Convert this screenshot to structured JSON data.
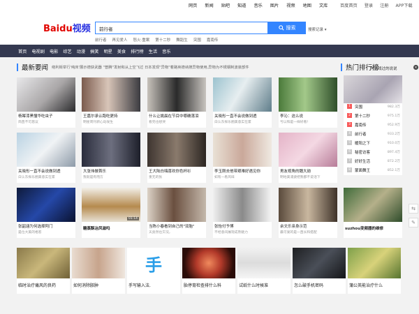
{
  "top_nav": {
    "center": [
      "网页",
      "新闻",
      "贴吧",
      "知道",
      "音乐",
      "图片",
      "视频",
      "地图",
      "文库"
    ],
    "right": [
      "百度首页",
      "登录",
      "注册",
      "APP下载"
    ]
  },
  "logo": {
    "part1": "Baidu",
    "part2": "视频"
  },
  "search": {
    "value": "前行者",
    "button": "搜索",
    "history": "搜索记录"
  },
  "suggestions": [
    "前行者",
    "再见爱人",
    "怒火·重案",
    "第十二秒",
    "舞蹈生",
    "突围",
    "嘉南传"
  ],
  "category_nav": [
    "首页",
    "电视剧",
    "电影",
    "综艺",
    "动漫",
    "搞笑",
    "明星",
    "美食",
    "排行榜",
    "生活",
    "音乐"
  ],
  "news": {
    "title": "最新要闻",
    "ticker": "络利街举行'纯床'展示德获武器    \"普腾\"发射和从上空飞过    日本发现\"异物\"着路英德纳搜异物使用,异物为不锈钢制波装部件"
  },
  "cards": [
    {
      "title": "杨幂漆黑懂华吃虫子",
      "sub": "简直不可思议"
    },
    {
      "title": "王嘉尔承认跑吃更持",
      "sub": "明星周刊新心动发生"
    },
    {
      "title": "什么让姚晨在节目中哪确落泪",
      "sub": "看完也想哭"
    },
    {
      "title": "关晓彤一直不会说做到透",
      "sub": "白认东探乐圈美意实在累"
    },
    {
      "title": "李沁：这么说",
      "sub": "亏以和是一样好看！"
    },
    {
      "title": "关晓彤一直不会说做到透",
      "sub": "白认东探乐圈美意实在累"
    },
    {
      "title": "大张伟做首乐",
      "sub": "我就是有而方"
    },
    {
      "title": "王大陆白嗨喜欢你色杯衫",
      "sub": "重无的张"
    },
    {
      "title": "李玉刚去他带艰难好遇见你",
      "sub": "如有一看风味"
    },
    {
      "title": "男友视角的魏大勋",
      "sub": "明地美浦姿把我都不说话下"
    },
    {
      "title": "张韶涵为何选择阿门",
      "sub": "是位大美的格客"
    },
    {
      "title": "糖蒸酥冶风滋吗",
      "sub": ""
    },
    {
      "title": "当陈小春看到自己的\"双胎\"",
      "sub": "天竟然也灾况，"
    },
    {
      "title": "张怡付予博",
      "sub": "不经意间展现成熟魅力"
    },
    {
      "title": "余文乐亲身示范",
      "sub": "最可爱的是一直长和搭配"
    },
    {
      "title": "suzhou变频器的维修",
      "sub": ""
    }
  ],
  "badges": {
    "card_badge": "01:14"
  },
  "hot_rank": {
    "title": "热门排行榜",
    "overlay": "内心戏过的说说",
    "items": [
      {
        "rank": "1",
        "name": "突围",
        "value": "982.3万"
      },
      {
        "rank": "2",
        "name": "第十二秒",
        "value": "975.1万"
      },
      {
        "rank": "3",
        "name": "嘉南传",
        "value": "952.9万"
      },
      {
        "rank": "4",
        "name": "前行者",
        "value": "933.2万"
      },
      {
        "rank": "5",
        "name": "暖阳之下",
        "value": "910.0万"
      },
      {
        "rank": "6",
        "name": "秘密访客",
        "value": "897.4万"
      },
      {
        "rank": "7",
        "name": "好好生活",
        "value": "872.2万"
      },
      {
        "rank": "8",
        "name": "蒙面舞王",
        "value": "852.1万"
      }
    ]
  },
  "bottom_cards": [
    "临时治疗痛风的良药",
    "如何消除脓肿",
    "手写输入法.",
    "胎停育检查排什么科",
    "试纸什么时候准",
    "怎么破手机密码",
    "蒲公英能治疗什么"
  ],
  "colors": {
    "accent": "#3385ff",
    "nav_bg": "#343950",
    "rank_hot": "#f85959",
    "rank_normal": "#c8c8c8"
  }
}
